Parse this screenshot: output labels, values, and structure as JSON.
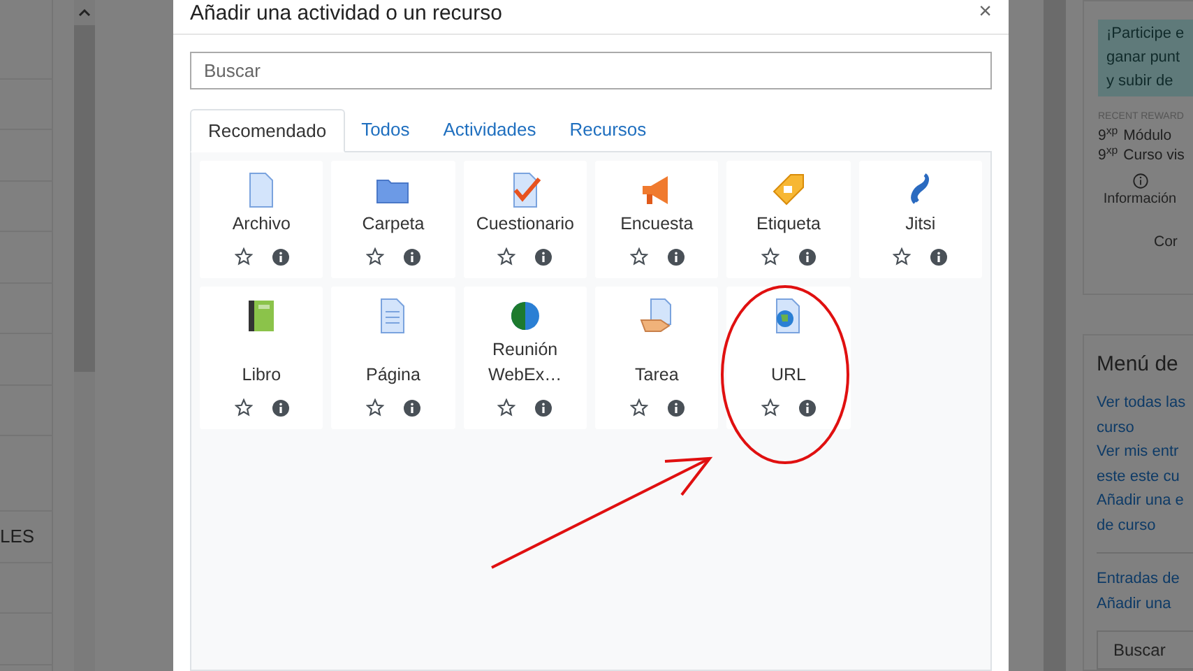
{
  "background_left": {
    "labels": [
      "LES"
    ]
  },
  "modal": {
    "title": "Añadir una actividad o un recurso",
    "close": "×",
    "search": {
      "placeholder": "Buscar"
    },
    "tabs": [
      {
        "label": "Recomendado",
        "selected": true
      },
      {
        "label": "Todos",
        "selected": false
      },
      {
        "label": "Actividades",
        "selected": false
      },
      {
        "label": "Recursos",
        "selected": false
      }
    ],
    "items": [
      {
        "name": "Archivo",
        "kind": "file",
        "starred": false
      },
      {
        "name": "Carpeta",
        "kind": "folder",
        "starred": false
      },
      {
        "name": "Cuestionario",
        "kind": "quiz",
        "starred": false
      },
      {
        "name": "Encuesta",
        "kind": "megaphone",
        "starred": false
      },
      {
        "name": "Etiqueta",
        "kind": "tag",
        "starred": false
      },
      {
        "name": "Jitsi",
        "kind": "swirl",
        "starred": false
      },
      {
        "name": "Libro",
        "kind": "book",
        "starred": false
      },
      {
        "name": "Página",
        "kind": "page",
        "starred": false
      },
      {
        "name": "Reunión WebEx…",
        "kind": "globe",
        "starred": false
      },
      {
        "name": "Tarea",
        "kind": "hand",
        "starred": false
      },
      {
        "name": "URL",
        "kind": "url",
        "starred": false
      }
    ]
  },
  "right_panel": {
    "notice_lines": [
      "¡Participe e",
      "ganar punt",
      "y subir de"
    ],
    "recent_label": "RECENT REWARD",
    "rewards": [
      {
        "points": "9$^{xp}$",
        "text": "Módulo"
      },
      {
        "points": "9$^{xp}$",
        "text": "Curso vis"
      }
    ],
    "info_label": "Información",
    "cut_label": "Cor",
    "menu_title": "Menú de",
    "menu_links": [
      "Ver todas las",
      "curso",
      "Ver mis entr",
      "este este cu",
      "Añadir una e",
      "de curso"
    ],
    "links_2": [
      "Entradas de",
      "Añadir una"
    ],
    "search_placeholder": "Buscar"
  }
}
